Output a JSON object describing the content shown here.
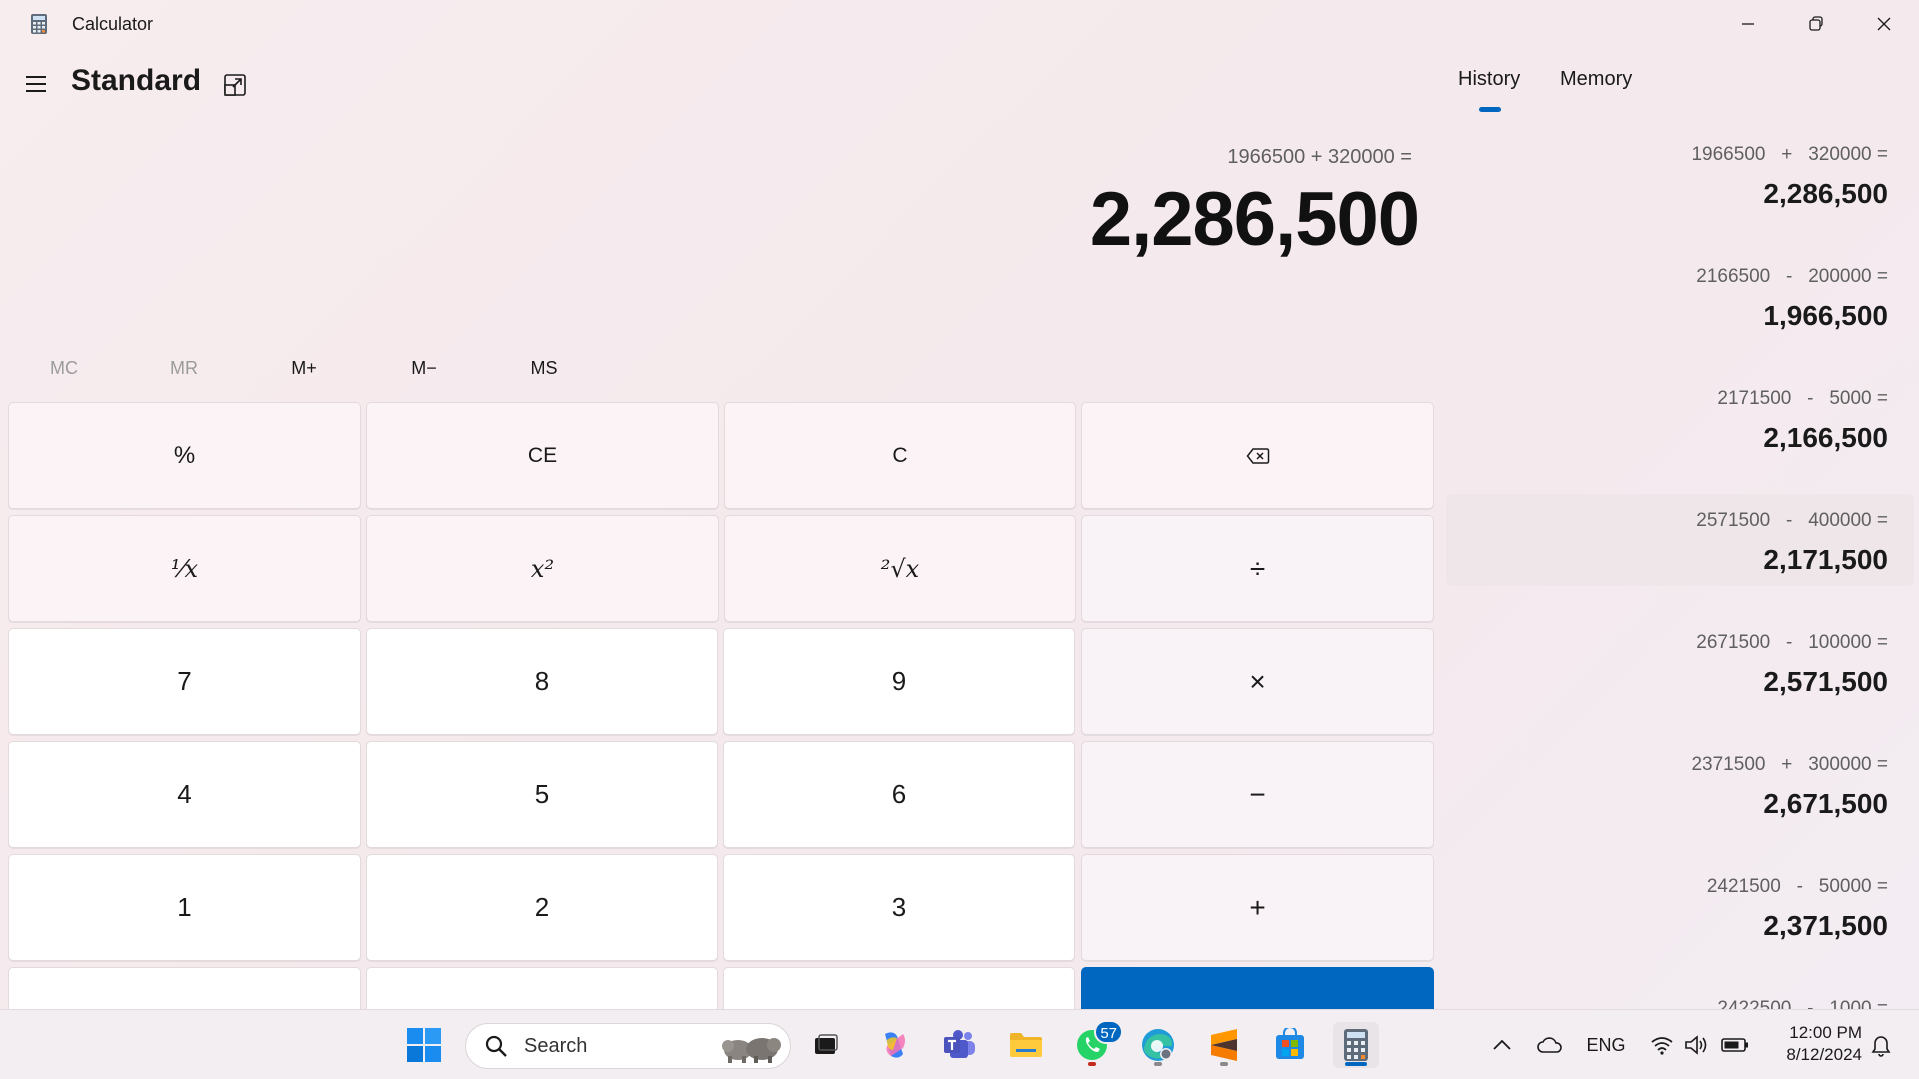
{
  "window": {
    "title": "Calculator",
    "minimize_label": "Minimize",
    "restore_label": "Restore",
    "close_label": "Close"
  },
  "header": {
    "mode_title": "Standard",
    "tabs": [
      {
        "label": "History",
        "active": true
      },
      {
        "label": "Memory",
        "active": false
      }
    ]
  },
  "display": {
    "expression": "1966500 + 320000 =",
    "result": "2,286,500"
  },
  "memory_buttons": [
    {
      "label": "MC",
      "enabled": false
    },
    {
      "label": "MR",
      "enabled": false
    },
    {
      "label": "M+",
      "enabled": true
    },
    {
      "label": "M−",
      "enabled": true
    },
    {
      "label": "MS",
      "enabled": true
    }
  ],
  "keypad": {
    "percent": "%",
    "clear_entry": "CE",
    "clear": "C",
    "backspace_icon": "backspace-icon",
    "reciprocal": "⅟x",
    "square": "x²",
    "sqrt": "²√x",
    "divide": "÷",
    "multiply": "×",
    "minus": "−",
    "plus": "+",
    "digits": [
      "7",
      "8",
      "9",
      "4",
      "5",
      "6",
      "1",
      "2",
      "3"
    ]
  },
  "history": [
    {
      "expr": "1966500   +   320000 =",
      "value": "2,286,500"
    },
    {
      "expr": "2166500   -   200000 =",
      "value": "1,966,500"
    },
    {
      "expr": "2171500   -   5000 =",
      "value": "2,166,500"
    },
    {
      "expr": "2571500   -   400000 =",
      "value": "2,171,500"
    },
    {
      "expr": "2671500   -   100000 =",
      "value": "2,571,500"
    },
    {
      "expr": "2371500   +   300000 =",
      "value": "2,671,500"
    },
    {
      "expr": "2421500   -   50000 =",
      "value": "2,371,500"
    },
    {
      "expr": "2422500   -   1000 =",
      "value": ""
    }
  ],
  "taskbar": {
    "search_placeholder": "Search",
    "whatsapp_badge": "57",
    "language": "ENG",
    "time": "12:00 PM",
    "date": "8/12/2024"
  },
  "colors": {
    "accent": "#0067c0",
    "background": "#f5eaec"
  }
}
